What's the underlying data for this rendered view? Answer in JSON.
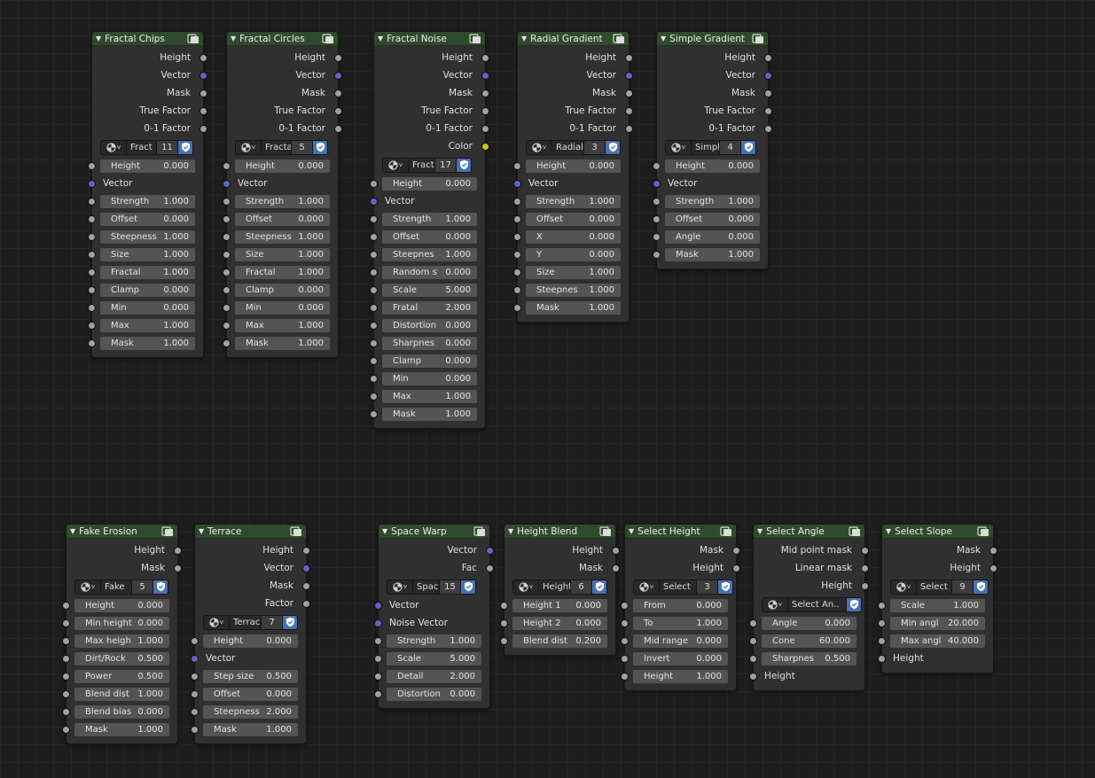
{
  "colors": {
    "background": "#1d1d1d",
    "node_body": "#303030",
    "node_header": "#2f4a2c",
    "field": "#545454",
    "socket_float": "#a1a1a1",
    "socket_vector": "#6363c7",
    "socket_color": "#c7c729",
    "fake_user_active": "#4772b3"
  },
  "nodes": [
    {
      "title": "Fractal Chips",
      "outputs": [
        {
          "label": "Height",
          "type": "float"
        },
        {
          "label": "Vector",
          "type": "vector"
        },
        {
          "label": "Mask",
          "type": "float"
        },
        {
          "label": "True Factor",
          "type": "float"
        },
        {
          "label": "0-1 Factor",
          "type": "float"
        }
      ],
      "datablock": {
        "name": "Fract",
        "count": "11"
      },
      "inputs": [
        {
          "label": "Height",
          "value": "0.000",
          "type": "float"
        },
        {
          "label": "Vector",
          "type": "vector"
        },
        {
          "label": "Strength",
          "value": "1.000",
          "type": "float"
        },
        {
          "label": "Offset",
          "value": "0.000",
          "type": "float"
        },
        {
          "label": "Steepness",
          "value": "1.000",
          "type": "float"
        },
        {
          "label": "Size",
          "value": "1.000",
          "type": "float"
        },
        {
          "label": "Fractal",
          "value": "1.000",
          "type": "float"
        },
        {
          "label": "Clamp",
          "value": "0.000",
          "type": "float"
        },
        {
          "label": "Min",
          "value": "0.000",
          "type": "float"
        },
        {
          "label": "Max",
          "value": "1.000",
          "type": "float"
        },
        {
          "label": "Mask",
          "value": "1.000",
          "type": "float"
        }
      ]
    },
    {
      "title": "Fractal Circles",
      "outputs": [
        {
          "label": "Height",
          "type": "float"
        },
        {
          "label": "Vector",
          "type": "vector"
        },
        {
          "label": "Mask",
          "type": "float"
        },
        {
          "label": "True Factor",
          "type": "float"
        },
        {
          "label": "0-1 Factor",
          "type": "float"
        }
      ],
      "datablock": {
        "name": "Fracta",
        "count": "5"
      },
      "inputs": [
        {
          "label": "Height",
          "value": "0.000",
          "type": "float"
        },
        {
          "label": "Vector",
          "type": "vector"
        },
        {
          "label": "Strength",
          "value": "1.000",
          "type": "float"
        },
        {
          "label": "Offset",
          "value": "0.000",
          "type": "float"
        },
        {
          "label": "Steepness",
          "value": "1.000",
          "type": "float"
        },
        {
          "label": "Size",
          "value": "1.000",
          "type": "float"
        },
        {
          "label": "Fractal",
          "value": "1.000",
          "type": "float"
        },
        {
          "label": "Clamp",
          "value": "0.000",
          "type": "float"
        },
        {
          "label": "Min",
          "value": "0.000",
          "type": "float"
        },
        {
          "label": "Max",
          "value": "1.000",
          "type": "float"
        },
        {
          "label": "Mask",
          "value": "1.000",
          "type": "float"
        }
      ]
    },
    {
      "title": "Fractal Noise",
      "outputs": [
        {
          "label": "Height",
          "type": "float"
        },
        {
          "label": "Vector",
          "type": "vector"
        },
        {
          "label": "Mask",
          "type": "float"
        },
        {
          "label": "True Factor",
          "type": "float"
        },
        {
          "label": "0-1 Factor",
          "type": "float"
        },
        {
          "label": "Color",
          "type": "color"
        }
      ],
      "datablock": {
        "name": "Fract",
        "count": "17"
      },
      "inputs": [
        {
          "label": "Height",
          "value": "0.000",
          "type": "float"
        },
        {
          "label": "Vector",
          "type": "vector"
        },
        {
          "label": "Strength",
          "value": "1.000",
          "type": "float"
        },
        {
          "label": "Offset",
          "value": "0.000",
          "type": "float"
        },
        {
          "label": "Steepnes",
          "value": "1.000",
          "type": "float"
        },
        {
          "label": "Random s",
          "value": "0.000",
          "type": "float"
        },
        {
          "label": "Scale",
          "value": "5.000",
          "type": "float"
        },
        {
          "label": "Fratal",
          "value": "2.000",
          "type": "float"
        },
        {
          "label": "Distortion",
          "value": "0.000",
          "type": "float"
        },
        {
          "label": "Sharpnes",
          "value": "0.000",
          "type": "float"
        },
        {
          "label": "Clamp",
          "value": "0.000",
          "type": "float"
        },
        {
          "label": "Min",
          "value": "0.000",
          "type": "float"
        },
        {
          "label": "Max",
          "value": "1.000",
          "type": "float"
        },
        {
          "label": "Mask",
          "value": "1.000",
          "type": "float"
        }
      ]
    },
    {
      "title": "Radial Gradient",
      "outputs": [
        {
          "label": "Height",
          "type": "float"
        },
        {
          "label": "Vector",
          "type": "vector"
        },
        {
          "label": "Mask",
          "type": "float"
        },
        {
          "label": "True Factor",
          "type": "float"
        },
        {
          "label": "0-1 Factor",
          "type": "float"
        }
      ],
      "datablock": {
        "name": "Radial",
        "count": "3"
      },
      "inputs": [
        {
          "label": "Height",
          "value": "0.000",
          "type": "float"
        },
        {
          "label": "Vector",
          "type": "vector"
        },
        {
          "label": "Strength",
          "value": "1.000",
          "type": "float"
        },
        {
          "label": "Offset",
          "value": "0.000",
          "type": "float"
        },
        {
          "label": "X",
          "value": "0.000",
          "type": "float"
        },
        {
          "label": "Y",
          "value": "0.000",
          "type": "float"
        },
        {
          "label": "Size",
          "value": "1.000",
          "type": "float"
        },
        {
          "label": "Steepnes",
          "value": "1.000",
          "type": "float"
        },
        {
          "label": "Mask",
          "value": "1.000",
          "type": "float"
        }
      ]
    },
    {
      "title": "Simple Gradient",
      "outputs": [
        {
          "label": "Height",
          "type": "float"
        },
        {
          "label": "Vector",
          "type": "vector"
        },
        {
          "label": "Mask",
          "type": "float"
        },
        {
          "label": "True Factor",
          "type": "float"
        },
        {
          "label": "0-1 Factor",
          "type": "float"
        }
      ],
      "datablock": {
        "name": "Simpl",
        "count": "4"
      },
      "inputs": [
        {
          "label": "Height",
          "value": "0.000",
          "type": "float"
        },
        {
          "label": "Vector",
          "type": "vector"
        },
        {
          "label": "Strength",
          "value": "1.000",
          "type": "float"
        },
        {
          "label": "Offset",
          "value": "0.000",
          "type": "float"
        },
        {
          "label": "Angle",
          "value": "0.000",
          "type": "float"
        },
        {
          "label": "Mask",
          "value": "1.000",
          "type": "float"
        }
      ]
    },
    {
      "title": "Fake Erosion",
      "outputs": [
        {
          "label": "Height",
          "type": "float"
        },
        {
          "label": "Mask",
          "type": "float"
        }
      ],
      "datablock": {
        "name": "Fake",
        "count": "5"
      },
      "inputs": [
        {
          "label": "Height",
          "value": "0.000",
          "type": "float"
        },
        {
          "label": "Min height",
          "value": "0.000",
          "type": "float"
        },
        {
          "label": "Max heigh",
          "value": "1.000",
          "type": "float"
        },
        {
          "label": "Dirt/Rock",
          "value": "0.500",
          "type": "float"
        },
        {
          "label": "Power",
          "value": "0.500",
          "type": "float"
        },
        {
          "label": "Blend dist",
          "value": "1.000",
          "type": "float"
        },
        {
          "label": "Blend bias",
          "value": "0.000",
          "type": "float"
        },
        {
          "label": "Mask",
          "value": "1.000",
          "type": "float"
        }
      ]
    },
    {
      "title": "Terrace",
      "outputs": [
        {
          "label": "Height",
          "type": "float"
        },
        {
          "label": "Vector",
          "type": "vector"
        },
        {
          "label": "Mask",
          "type": "float"
        },
        {
          "label": "Factor",
          "type": "float"
        }
      ],
      "datablock": {
        "name": "Terrac",
        "count": "7"
      },
      "inputs": [
        {
          "label": "Height",
          "value": "0.000",
          "type": "float"
        },
        {
          "label": "Vector",
          "type": "vector"
        },
        {
          "label": "Step size",
          "value": "0.500",
          "type": "float"
        },
        {
          "label": "Offset",
          "value": "0.000",
          "type": "float"
        },
        {
          "label": "Steepness",
          "value": "2.000",
          "type": "float"
        },
        {
          "label": "Mask",
          "value": "1.000",
          "type": "float"
        }
      ]
    },
    {
      "title": "Space Warp",
      "outputs": [
        {
          "label": "Vector",
          "type": "vector"
        },
        {
          "label": "Fac",
          "type": "float"
        }
      ],
      "datablock": {
        "name": "Spac",
        "count": "15"
      },
      "inputs": [
        {
          "label": "Vector",
          "type": "vector"
        },
        {
          "label": "Noise Vector",
          "type": "vector"
        },
        {
          "label": "Strength",
          "value": "1.000",
          "type": "float"
        },
        {
          "label": "Scale",
          "value": "5.000",
          "type": "float"
        },
        {
          "label": "Detail",
          "value": "2.000",
          "type": "float"
        },
        {
          "label": "Distortion",
          "value": "0.000",
          "type": "float"
        }
      ]
    },
    {
      "title": "Height Blend",
      "outputs": [
        {
          "label": "Height",
          "type": "float"
        },
        {
          "label": "Mask",
          "type": "float"
        }
      ],
      "datablock": {
        "name": "Height",
        "count": "6"
      },
      "inputs": [
        {
          "label": "Height 1",
          "value": "0.000",
          "type": "float"
        },
        {
          "label": "Height 2",
          "value": "0.000",
          "type": "float"
        },
        {
          "label": "Blend dist",
          "value": "0.200",
          "type": "float"
        }
      ]
    },
    {
      "title": "Select Height",
      "outputs": [
        {
          "label": "Mask",
          "type": "float"
        },
        {
          "label": "Height",
          "type": "float"
        }
      ],
      "datablock": {
        "name": "Select",
        "count": "3"
      },
      "inputs": [
        {
          "label": "From",
          "value": "0.000",
          "type": "float"
        },
        {
          "label": "To",
          "value": "1.000",
          "type": "float"
        },
        {
          "label": "Mid range",
          "value": "0.000",
          "type": "float"
        },
        {
          "label": "Invert",
          "value": "0.000",
          "type": "float"
        },
        {
          "label": "Height",
          "value": "1.000",
          "type": "float"
        }
      ]
    },
    {
      "title": "Select Angle",
      "outputs": [
        {
          "label": "Mid point mask",
          "type": "float"
        },
        {
          "label": "Linear mask",
          "type": "float"
        },
        {
          "label": "Height",
          "type": "float"
        }
      ],
      "datablock": {
        "name": "Select An..",
        "count": ""
      },
      "inputs": [
        {
          "label": "Angle",
          "value": "0.000",
          "type": "float"
        },
        {
          "label": "Cone",
          "value": "60.000",
          "type": "float"
        },
        {
          "label": "Sharpnes",
          "value": "0.500",
          "type": "float"
        },
        {
          "label": "Height",
          "type": "float"
        }
      ]
    },
    {
      "title": "Select Slope",
      "outputs": [
        {
          "label": "Mask",
          "type": "float"
        },
        {
          "label": "Height",
          "type": "float"
        }
      ],
      "datablock": {
        "name": "Select",
        "count": "9"
      },
      "inputs": [
        {
          "label": "Scale",
          "value": "1.000",
          "type": "float"
        },
        {
          "label": "Min angl",
          "value": "20.000",
          "type": "float"
        },
        {
          "label": "Max angl",
          "value": "40.000",
          "type": "float"
        },
        {
          "label": "Height",
          "type": "float"
        }
      ]
    }
  ]
}
